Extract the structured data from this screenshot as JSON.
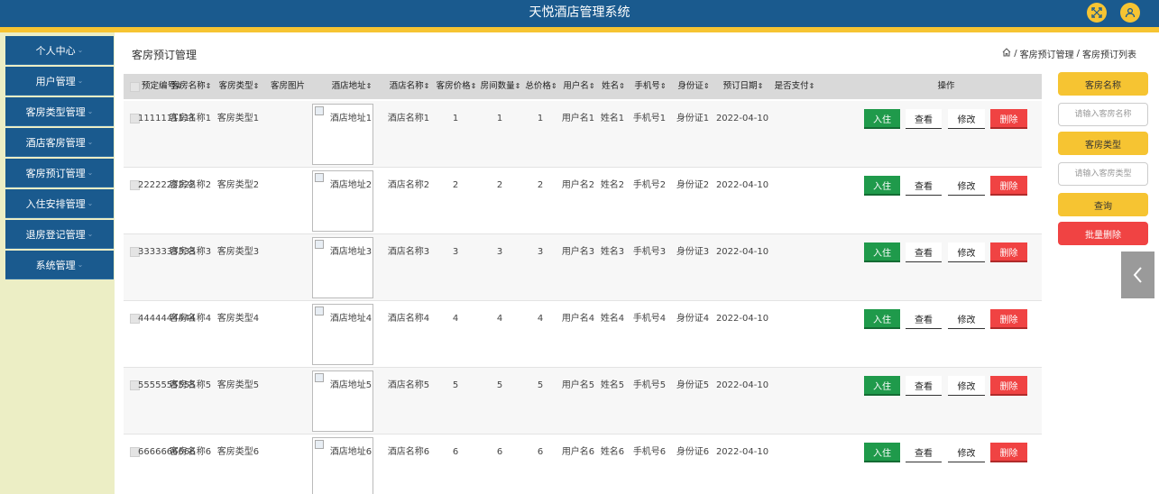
{
  "app": {
    "title": "天悦酒店管理系统"
  },
  "colors": {
    "header": "#1a5a8e",
    "accent": "#f6c432",
    "sidebar_bg": "#eceec5",
    "checkin": "#1f9a4b",
    "delete": "#f04343"
  },
  "header_icons": [
    "fullscreen-icon",
    "user-icon"
  ],
  "sidebar": {
    "items": [
      {
        "label": "个人中心"
      },
      {
        "label": "用户管理"
      },
      {
        "label": "客房类型管理"
      },
      {
        "label": "酒店客房管理"
      },
      {
        "label": "客房预订管理"
      },
      {
        "label": "入住安排管理"
      },
      {
        "label": "退房登记管理"
      },
      {
        "label": "系统管理"
      }
    ]
  },
  "page": {
    "title": "客房预订管理",
    "breadcrumb": [
      "客房预订管理",
      "客房预订列表"
    ],
    "breadcrumb_separator": "/"
  },
  "table": {
    "columns": [
      "预定编号",
      "客房名称",
      "客房类型",
      "客房图片",
      "酒店地址",
      "酒店名称",
      "客房价格",
      "房间数量",
      "总价格",
      "用户名",
      "姓名",
      "手机号",
      "身份证",
      "预订日期",
      "是否支付",
      "操作"
    ],
    "sortable": [
      "预定编号",
      "客房名称",
      "客房类型",
      "酒店地址",
      "酒店名称",
      "客房价格",
      "房间数量",
      "总价格",
      "用户名",
      "姓名",
      "手机号",
      "身份证",
      "预订日期",
      "是否支付"
    ],
    "actions": {
      "checkin": "入住",
      "view": "查看",
      "edit": "修改",
      "delete": "删除"
    },
    "rows": [
      {
        "id": "1111111111",
        "room_name": "客房名称1",
        "room_type": "客房类型1",
        "address": "酒店地址1",
        "hotel": "酒店名称1",
        "price": "1",
        "qty": "1",
        "total": "1",
        "username": "用户名1",
        "name": "姓名1",
        "phone": "手机号1",
        "idcard": "身份证1",
        "date": "2022-04-10",
        "paid": ""
      },
      {
        "id": "2222222222",
        "room_name": "客房名称2",
        "room_type": "客房类型2",
        "address": "酒店地址2",
        "hotel": "酒店名称2",
        "price": "2",
        "qty": "2",
        "total": "2",
        "username": "用户名2",
        "name": "姓名2",
        "phone": "手机号2",
        "idcard": "身份证2",
        "date": "2022-04-10",
        "paid": ""
      },
      {
        "id": "3333333333",
        "room_name": "客房名称3",
        "room_type": "客房类型3",
        "address": "酒店地址3",
        "hotel": "酒店名称3",
        "price": "3",
        "qty": "3",
        "total": "3",
        "username": "用户名3",
        "name": "姓名3",
        "phone": "手机号3",
        "idcard": "身份证3",
        "date": "2022-04-10",
        "paid": ""
      },
      {
        "id": "4444444444",
        "room_name": "客房名称4",
        "room_type": "客房类型4",
        "address": "酒店地址4",
        "hotel": "酒店名称4",
        "price": "4",
        "qty": "4",
        "total": "4",
        "username": "用户名4",
        "name": "姓名4",
        "phone": "手机号4",
        "idcard": "身份证4",
        "date": "2022-04-10",
        "paid": ""
      },
      {
        "id": "5555555555",
        "room_name": "客房名称5",
        "room_type": "客房类型5",
        "address": "酒店地址5",
        "hotel": "酒店名称5",
        "price": "5",
        "qty": "5",
        "total": "5",
        "username": "用户名5",
        "name": "姓名5",
        "phone": "手机号5",
        "idcard": "身份证5",
        "date": "2022-04-10",
        "paid": ""
      },
      {
        "id": "6666666666",
        "room_name": "客房名称6",
        "room_type": "客房类型6",
        "address": "酒店地址6",
        "hotel": "酒店名称6",
        "price": "6",
        "qty": "6",
        "total": "6",
        "username": "用户名6",
        "name": "姓名6",
        "phone": "手机号6",
        "idcard": "身份证6",
        "date": "2022-04-10",
        "paid": ""
      }
    ]
  },
  "search_panel": {
    "room_name_label": "客房名称",
    "room_name_placeholder": "请输入客房名称",
    "room_type_label": "客房类型",
    "room_type_placeholder": "请输入客房类型",
    "query_label": "查询",
    "batch_delete_label": "批量删除"
  }
}
